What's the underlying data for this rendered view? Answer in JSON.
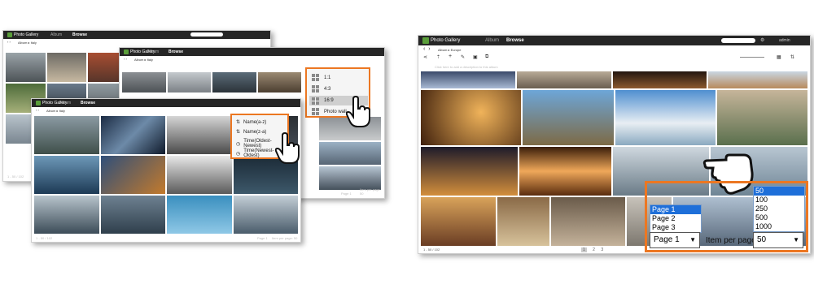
{
  "windows": {
    "back": {
      "app_name": "Photo Gallery",
      "tabs": [
        "Album",
        "Browse"
      ],
      "breadcrumb": "Album ▸ Italy"
    },
    "middle": {
      "app_name": "Photo Gallery",
      "tabs": [
        "Album",
        "Browse"
      ],
      "breadcrumb": "Album ▸ Italy"
    },
    "front": {
      "app_name": "Photo Gallery",
      "tabs": [
        "Album",
        "Browse"
      ],
      "breadcrumb": "Album ▸ Italy"
    },
    "main": {
      "app_name": "Photo Gallery",
      "tabs": [
        "Album",
        "Browse"
      ],
      "breadcrumb": "Album ▸ Europe",
      "description_placeholder": "Click here to add a description to this album",
      "item_count": "1 - 50 / 102",
      "pages": [
        "1",
        "2",
        "3"
      ],
      "user": "admin"
    }
  },
  "ratio_menu": {
    "items": [
      "1:1",
      "4:3",
      "16:9",
      "Photo wall"
    ],
    "selected": "16:9"
  },
  "sort_menu": {
    "items": [
      "Name(a-z)",
      "Name(z-a)",
      "Time(Oldest-Newest)",
      "Time(Newest-Oldest)"
    ],
    "icons": [
      "sort-az-icon",
      "sort-za-icon",
      "clock-icon",
      "clock-icon"
    ]
  },
  "pager": {
    "page_options": [
      "Page 1",
      "Page 2",
      "Page 3"
    ],
    "page_selected": "Page 1",
    "ipp_label": "Item per page",
    "ipp_options": [
      "50",
      "100",
      "250",
      "500",
      "1000"
    ],
    "ipp_selected": "50"
  },
  "footer_small": {
    "left": "1 - 50 / 102",
    "page_label": "Page 1",
    "ipp_label": "Item per page: 50"
  },
  "colors": {
    "accent": "#ec7722",
    "topbar": "#262626",
    "select_blue": "#1e6fd9"
  }
}
